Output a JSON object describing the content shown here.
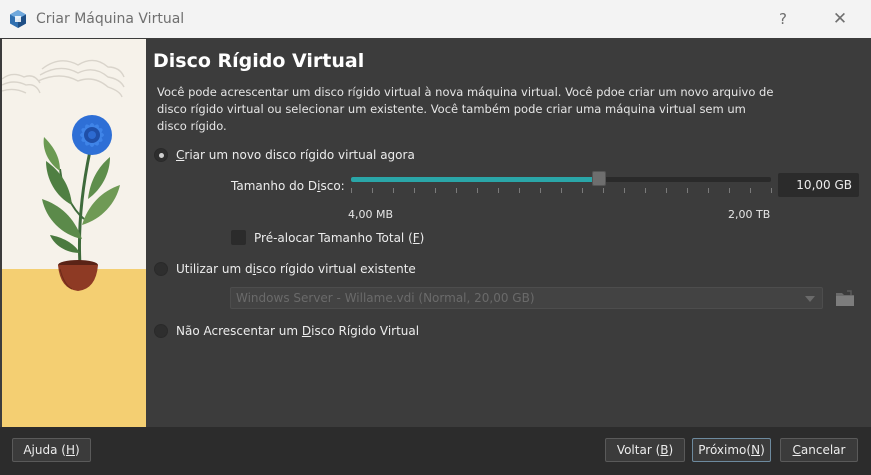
{
  "window": {
    "title": "Criar Máquina Virtual",
    "help_label": "?",
    "close_label": "✕"
  },
  "page": {
    "heading": "Disco Rígido Virtual",
    "description": "Você pode acrescentar um disco rígido virtual à nova máquina virtual. Você pdoe criar um novo arquivo de disco rígido virtual ou selecionar um existente. Você também pode criar uma máquina virtual sem um disco rígido."
  },
  "options": {
    "create_new": {
      "pre": "",
      "mnemonic": "C",
      "post": "riar um novo disco rígido virtual agora",
      "selected": true
    },
    "use_existing": {
      "pre": "Utilizar um d",
      "mnemonic": "i",
      "post": "sco rígido virtual existente",
      "selected": false
    },
    "no_disk": {
      "pre": "Não Acrescentar um ",
      "mnemonic": "D",
      "post": "isco Rígido Virtual",
      "selected": false
    }
  },
  "disk_size": {
    "label_pre": "Tamanho do D",
    "label_mnemonic": "i",
    "label_post": "sco:",
    "value": "10,00 GB",
    "slider_fraction": 0.59,
    "min_label": "4,00 MB",
    "max_label": "2,00 TB"
  },
  "preallocate": {
    "label_pre": "Pré-alocar Tamanho Total (",
    "label_mnemonic": "F",
    "label_post": ")",
    "checked": false
  },
  "existing_disk": {
    "selected": "Windows Server - Willame.vdi (Normal, 20,00 GB)",
    "enabled": false
  },
  "buttons": {
    "help": {
      "pre": "Ajuda (",
      "mnemonic": "H",
      "post": ")"
    },
    "back": {
      "pre": "Voltar (",
      "mnemonic": "B",
      "post": ")"
    },
    "next": {
      "pre": "Próximo(",
      "mnemonic": "N",
      "post": ")"
    },
    "cancel": {
      "pre": "",
      "mnemonic": "C",
      "post": "ancelar"
    }
  },
  "icons": {
    "app": "virtualbox-icon",
    "folder": "folder-icon"
  },
  "colors": {
    "accent": "#2aa6a8",
    "background": "#3c3c3c"
  }
}
